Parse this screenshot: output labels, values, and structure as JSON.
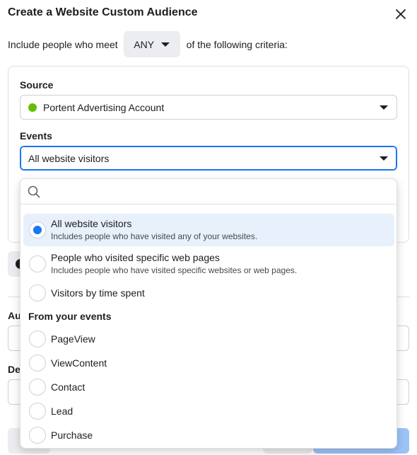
{
  "dialog": {
    "title": "Create a Website Custom Audience",
    "close_icon": "close-icon"
  },
  "criteria": {
    "prefix": "Include people who meet",
    "match_value": "ANY",
    "suffix": "of the following criteria:"
  },
  "source": {
    "label": "Source",
    "value": "Portent Advertising Account",
    "status_color": "#63be09"
  },
  "events": {
    "label": "Events",
    "value": "All website visitors"
  },
  "dropdown": {
    "search_placeholder": "",
    "options": [
      {
        "title": "All website visitors",
        "desc": "Includes people who have visited any of your websites.",
        "selected": true
      },
      {
        "title": "People who visited specific web pages",
        "desc": "Includes people who have visited specific websites or web pages.",
        "selected": false
      },
      {
        "title": "Visitors by time spent",
        "desc": "",
        "selected": false
      }
    ],
    "section_heading": "From your events",
    "event_options": [
      "PageView",
      "ViewContent",
      "Contact",
      "Lead",
      "Purchase"
    ]
  },
  "background": {
    "label_1": "Au",
    "label_2": "De"
  },
  "colors": {
    "accent": "#1877f2",
    "selected_bg": "#e7f0fb"
  }
}
